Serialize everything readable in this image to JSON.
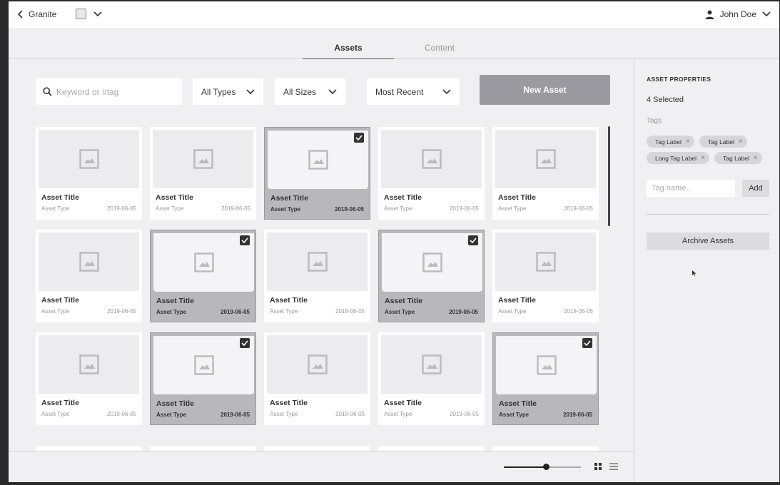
{
  "topbar": {
    "back_label": "Granite",
    "user_name": "John Doe"
  },
  "tabs": [
    {
      "label": "Assets",
      "active": true
    },
    {
      "label": "Content",
      "active": false
    }
  ],
  "toolbar": {
    "search_placeholder": "Keyword or #tag",
    "type_filter": "All Types",
    "size_filter": "All Sizes",
    "sort": "Most Recent",
    "new_asset_label": "New Asset"
  },
  "assets": [
    {
      "title": "Asset Title",
      "type": "Asset Type",
      "date": "2019-06-05",
      "selected": false
    },
    {
      "title": "Asset Title",
      "type": "Asset Type",
      "date": "2019-06-05",
      "selected": false
    },
    {
      "title": "Asset Title",
      "type": "Asset Type",
      "date": "2019-06-05",
      "selected": true
    },
    {
      "title": "Asset Title",
      "type": "Asset Type",
      "date": "2019-06-05",
      "selected": false
    },
    {
      "title": "Asset Title",
      "type": "Asset Type",
      "date": "2019-06-05",
      "selected": false
    },
    {
      "title": "Asset Title",
      "type": "Asset Type",
      "date": "2019-06-05",
      "selected": false
    },
    {
      "title": "Asset Title",
      "type": "Asset Type",
      "date": "2019-06-05",
      "selected": true
    },
    {
      "title": "Asset Title",
      "type": "Asset Type",
      "date": "2019-06-05",
      "selected": false
    },
    {
      "title": "Asset Title",
      "type": "Asset Type",
      "date": "2019-06-05",
      "selected": true
    },
    {
      "title": "Asset Title",
      "type": "Asset Type",
      "date": "2019-06-05",
      "selected": false
    },
    {
      "title": "Asset Title",
      "type": "Asset Type",
      "date": "2019-06-05",
      "selected": false
    },
    {
      "title": "Asset Title",
      "type": "Asset Type",
      "date": "2019-06-05",
      "selected": true
    },
    {
      "title": "Asset Title",
      "type": "Asset Type",
      "date": "2019-06-05",
      "selected": false
    },
    {
      "title": "Asset Title",
      "type": "Asset Type",
      "date": "2019-06-05",
      "selected": false
    },
    {
      "title": "Asset Title",
      "type": "Asset Type",
      "date": "2019-06-05",
      "selected": true
    }
  ],
  "footer": {
    "thumb_size": 0.55
  },
  "panel": {
    "heading": "ASSET PROPERTIES",
    "selected_text": "4 Selected",
    "tags_label": "Tags",
    "tags": [
      "Tag Label",
      "Tag Label",
      "Long Tag Label",
      "Tag Label"
    ],
    "tag_placeholder": "Tag name...",
    "add_label": "Add",
    "archive_label": "Archive Assets"
  },
  "icons": {
    "back": "chevron-left-icon",
    "document": "document-icon",
    "user": "user-icon",
    "search": "search-icon",
    "chevron": "chevron-down-icon",
    "image": "image-placeholder-icon",
    "check": "checkbox-checked-icon",
    "grid": "grid-view-icon",
    "list": "list-view-icon",
    "remove": "close-icon"
  }
}
